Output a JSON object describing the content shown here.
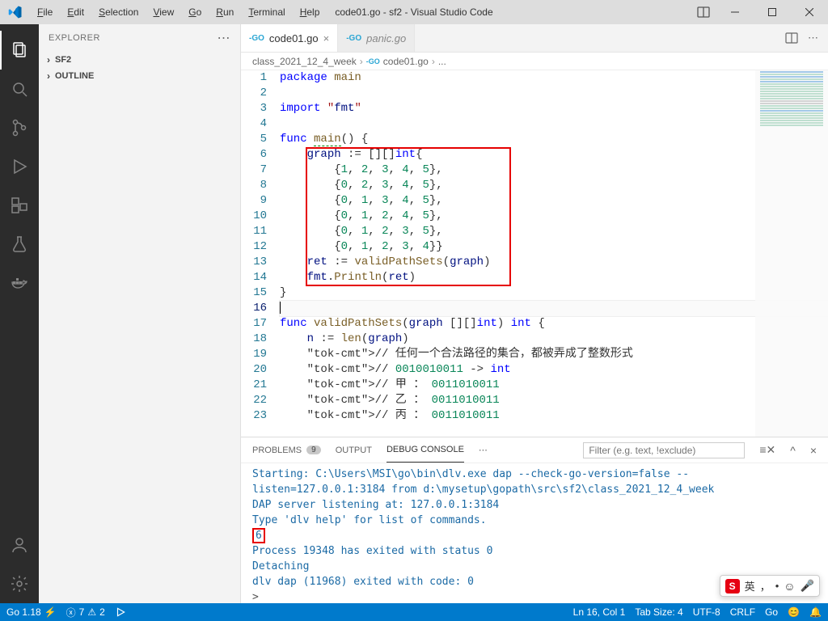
{
  "window": {
    "title": "code01.go - sf2 - Visual Studio Code"
  },
  "menu": {
    "file": "File",
    "edit": "Edit",
    "selection": "Selection",
    "view": "View",
    "go": "Go",
    "run": "Run",
    "terminal": "Terminal",
    "help": "Help"
  },
  "sidebar": {
    "header": "EXPLORER",
    "sections": {
      "sf2": "SF2",
      "outline": "OUTLINE"
    }
  },
  "tabs": {
    "active": {
      "filename": "code01.go"
    },
    "inactive": {
      "filename": "panic.go"
    }
  },
  "breadcrumb": {
    "folder": "class_2021_12_4_week",
    "file": "code01.go",
    "trailing": "..."
  },
  "editor": {
    "lines": [
      "package main",
      "",
      "import \"fmt\"",
      "",
      "func main() {",
      "    graph := [][]int{",
      "        {1, 2, 3, 4, 5},",
      "        {0, 2, 3, 4, 5},",
      "        {0, 1, 3, 4, 5},",
      "        {0, 1, 2, 4, 5},",
      "        {0, 1, 2, 3, 5},",
      "        {0, 1, 2, 3, 4}}",
      "    ret := validPathSets(graph)",
      "    fmt.Println(ret)",
      "}",
      "",
      "func validPathSets(graph [][]int) int {",
      "    n := len(graph)",
      "    // 任何一个合法路径的集合，都被弄成了整数形式",
      "    // 0010010011 -> int",
      "    // 甲 ： 0011010011",
      "    // 乙 ： 0011010011",
      "    // 丙 ： 0011010011"
    ],
    "cursor_line": 16
  },
  "panel": {
    "tabs": {
      "problems": "PROBLEMS",
      "problems_count": "9",
      "output": "OUTPUT",
      "debug": "DEBUG CONSOLE"
    },
    "filter_placeholder": "Filter (e.g. text, !exclude)",
    "lines": [
      "Starting: C:\\Users\\MSI\\go\\bin\\dlv.exe dap --check-go-version=false --listen=127.0.0.1:3184 from d:\\mysetup\\gopath\\src\\sf2\\class_2021_12_4_week",
      "DAP server listening at: 127.0.0.1:3184",
      "Type 'dlv help' for list of commands.",
      "6",
      "Process 19348 has exited with status 0",
      "Detaching",
      "dlv dap (11968) exited with code: 0"
    ],
    "prompt": ">"
  },
  "statusbar": {
    "go_version": "Go 1.18",
    "errs": "7",
    "warns": "2",
    "ln_col": "Ln 16, Col 1",
    "tab_size": "Tab Size: 4",
    "encoding": "UTF-8",
    "eol": "CRLF",
    "lang": "Go"
  },
  "ime": {
    "label": "英",
    "comma": "，",
    "bullet": "•"
  }
}
